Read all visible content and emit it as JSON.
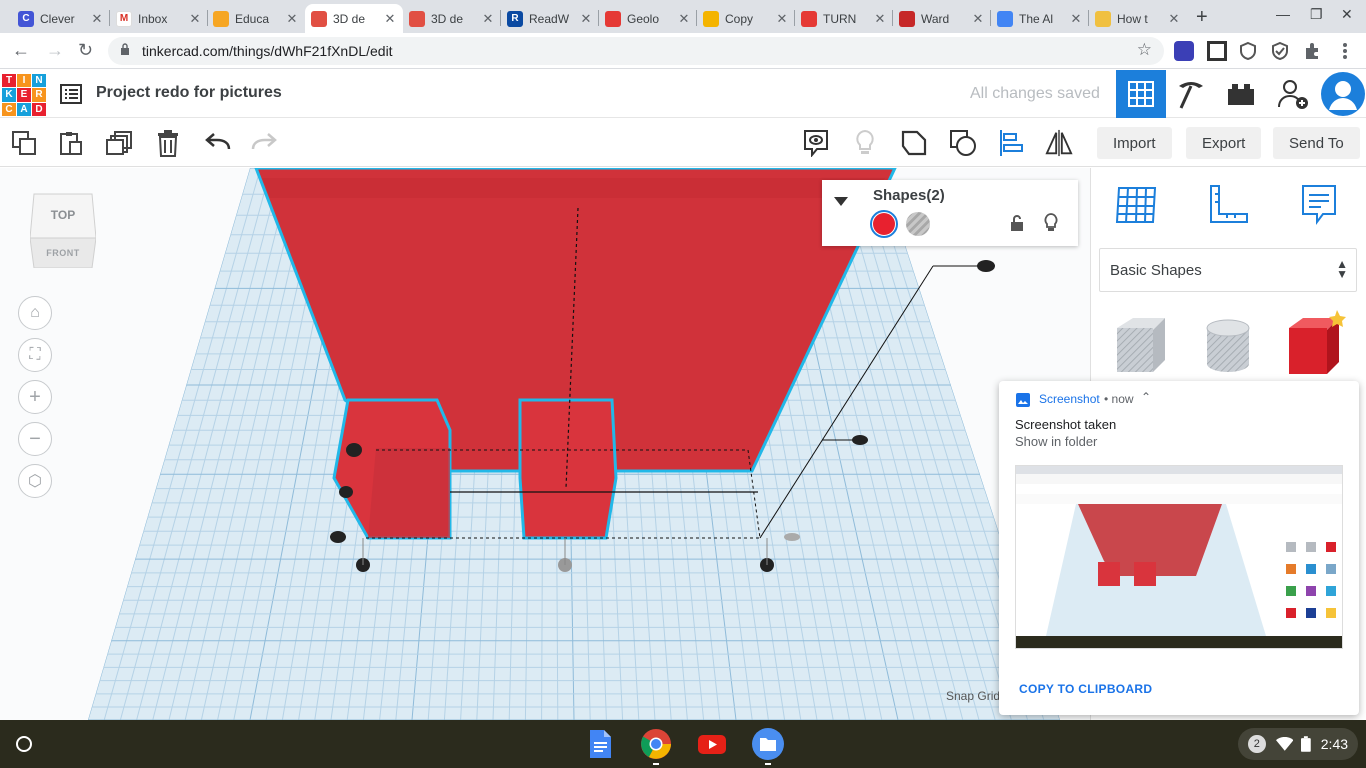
{
  "browser": {
    "tabs": [
      {
        "label": "Clever",
        "fav": "C",
        "color": "#4355d6"
      },
      {
        "label": "Inbox",
        "fav": "M",
        "color": "#fff"
      },
      {
        "label": "Educa",
        "fav": "",
        "color": "#f6a623"
      },
      {
        "label": "3D de",
        "fav": "",
        "color": "#e14f43"
      },
      {
        "label": "3D de",
        "fav": "",
        "color": "#e14f43"
      },
      {
        "label": "ReadW",
        "fav": "R",
        "color": "#0b4aa2"
      },
      {
        "label": "Geolo",
        "fav": "",
        "color": "#e53935"
      },
      {
        "label": "Copy",
        "fav": "",
        "color": "#f4b400"
      },
      {
        "label": "TURN",
        "fav": "",
        "color": "#e53935"
      },
      {
        "label": "Ward",
        "fav": "",
        "color": "#c62828"
      },
      {
        "label": "The Al",
        "fav": "",
        "color": "#4285f4"
      },
      {
        "label": "How t",
        "fav": "",
        "color": "#f0c040"
      }
    ],
    "url": "tinkercad.com/things/dWhF21fXnDL/edit"
  },
  "tinkercad": {
    "logo_letters": [
      "T",
      "I",
      "N",
      "K",
      "E",
      "R",
      "C",
      "A",
      "D"
    ],
    "project_title": "Project redo for pictures",
    "save_status": "All changes saved",
    "import_label": "Import",
    "export_label": "Export",
    "sendto_label": "Send To",
    "viewcube_top": "TOP",
    "viewcube_front": "FRONT",
    "snap_label": "Snap Grid",
    "inspector_title": "Shapes(2)",
    "shape_category": "Basic Shapes",
    "colors": {
      "solid": "#e8212f",
      "brand_blue": "#1c7fdb"
    }
  },
  "notification": {
    "app": "Screenshot",
    "when": "• now",
    "heading": "Screenshot taken",
    "subtext": "Show in folder",
    "action": "COPY TO CLIPBOARD"
  },
  "shelf": {
    "notif_count": "2",
    "time": "2:43"
  }
}
